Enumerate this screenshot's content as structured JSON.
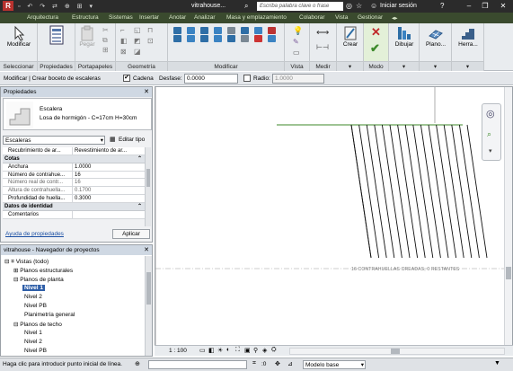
{
  "titlebar": {
    "app_title": "vitrahouse...",
    "search_placeholder": "Escriba palabra clave o frase",
    "user_label": "Iniciar sesión",
    "minimize_glyph": "–",
    "restore_glyph": "❐",
    "close_glyph": "✕"
  },
  "menubar": {
    "items": [
      "Arquitectura",
      "Estructura",
      "Sistemas",
      "Insertar",
      "Anotar",
      "Analizar",
      "Masa y emplazamiento",
      "Colaborar",
      "Vista",
      "Gestionar"
    ]
  },
  "ribbon": {
    "modify_label": "Modificar",
    "properties_label": "Propiedades",
    "paste_label": "Pegar",
    "create_label": "Crear",
    "draw_label": "Dibujar",
    "plan_label": "Plano...",
    "tools_label": "Herra...",
    "panels": {
      "select": "Seleccionar",
      "properties": "Propiedades",
      "clipboard": "Portapapeles",
      "geometry": "Geometría",
      "modify": "Modificar",
      "view": "Vista",
      "measure": "Medir",
      "mode": "Modo"
    }
  },
  "optionsbar": {
    "context": "Modificar | Crear boceto de escaleras",
    "chain_label": "Cadena",
    "chain_checked": true,
    "offset_label": "Desfase:",
    "offset_value": "0.0000",
    "radius_label": "Radio:",
    "radius_value": "1.0000",
    "radius_checked": false
  },
  "properties": {
    "title": "Propiedades",
    "type_family": "Escalera",
    "type_name": "Losa de hormigón - C=17cm H=30cm",
    "filter_value": "Escaleras",
    "edit_type_label": "Editar tipo",
    "cutoff_row": {
      "key": "Recubrimiento de ar...",
      "value": "Revestimiento de ar..."
    },
    "sections": [
      {
        "name": "Cotas",
        "rows": [
          {
            "key": "Anchura",
            "value": "1.0000"
          },
          {
            "key": "Número de contrahue...",
            "value": "16"
          },
          {
            "key": "Número real de contr...",
            "value": "16"
          },
          {
            "key": "Altura de contrahuella...",
            "value": "0.1700"
          },
          {
            "key": "Profundidad de huella...",
            "value": "0.3000"
          }
        ]
      },
      {
        "name": "Datos de identidad",
        "rows": [
          {
            "key": "Comentarios",
            "value": ""
          }
        ]
      }
    ],
    "help_link": "Ayuda de propiedades",
    "apply_label": "Aplicar"
  },
  "navigator": {
    "title": "vitrahouse - Navegador de proyectos",
    "items": [
      {
        "label": "Vistas (todo)",
        "indent": 0,
        "toggle": "⊟"
      },
      {
        "label": "Planos estructurales",
        "indent": 1,
        "toggle": "⊞"
      },
      {
        "label": "Planos de planta",
        "indent": 1,
        "toggle": "⊟"
      },
      {
        "label": "Nivel 1",
        "indent": 2,
        "toggle": "",
        "selected": true
      },
      {
        "label": "Nivel 2",
        "indent": 2,
        "toggle": ""
      },
      {
        "label": "Nivel PB",
        "indent": 2,
        "toggle": ""
      },
      {
        "label": "Planimetría general",
        "indent": 2,
        "toggle": ""
      },
      {
        "label": "Planos de techo",
        "indent": 1,
        "toggle": "⊟"
      },
      {
        "label": "Nivel 1",
        "indent": 2,
        "toggle": ""
      },
      {
        "label": "Nivel 2",
        "indent": 2,
        "toggle": ""
      },
      {
        "label": "Nivel PB",
        "indent": 2,
        "toggle": ""
      }
    ]
  },
  "viewport": {
    "stair_annotation": "16 CONTRAHUELLAS CREADAS, 0 RESTANTES",
    "scale": "1 : 100",
    "riser_count": 16
  },
  "statusbar": {
    "hint": "Haga clic para introducir punto inicial de línea.",
    "workset_value": ":0",
    "model_value": "Modelo base"
  },
  "colors": {
    "accent_green": "#3d8a2a",
    "ribbon_bg": "#e9ecef",
    "title_bg": "#2b2b2b"
  }
}
